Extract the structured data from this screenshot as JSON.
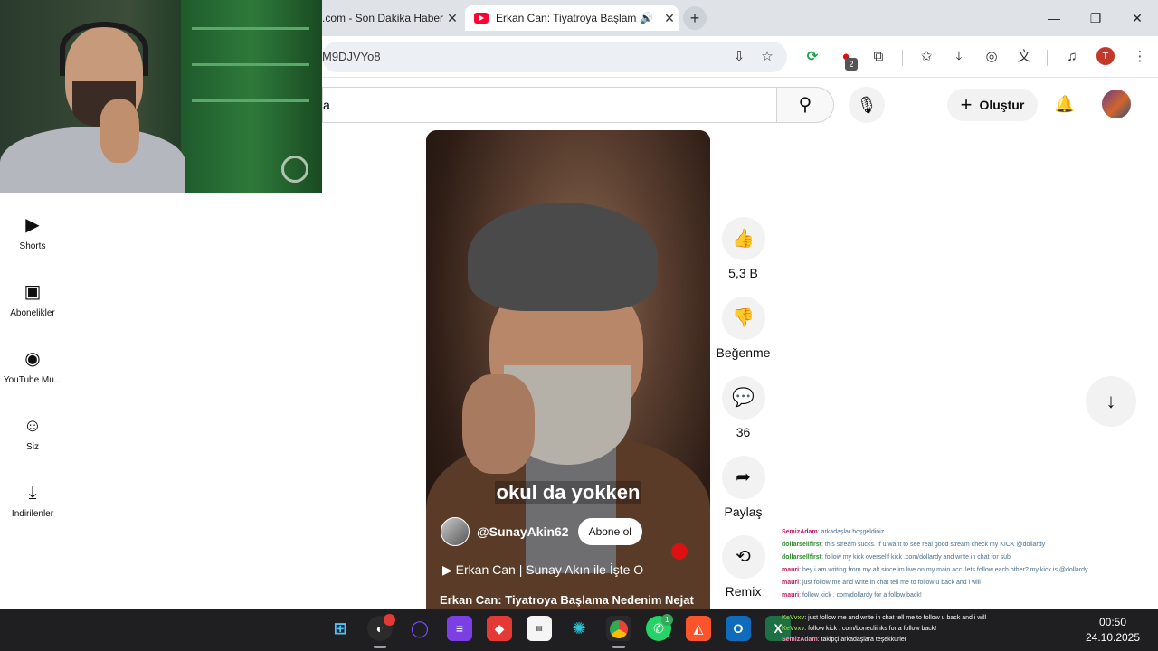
{
  "browser": {
    "tabs": [
      {
        "label": ".com - Son Dakika Haberleri",
        "close": "✕"
      },
      {
        "label": "Erkan Can: Tiyatroya Başlama Nedenim",
        "close": "✕",
        "audio": "🔊"
      }
    ],
    "new_tab": "+",
    "window": {
      "minimize": "—",
      "maximize": "❐",
      "close": "✕"
    },
    "url": "M9DJVYo8",
    "extension_badge": "2",
    "profile_initial": "T"
  },
  "youtube": {
    "search_value": "a",
    "create_label": "Oluştur",
    "guide": [
      {
        "label": "Shorts"
      },
      {
        "label": "Abonelikler"
      },
      {
        "label": "YouTube Mu..."
      },
      {
        "label": "Siz"
      },
      {
        "label": "İndirilenler"
      }
    ],
    "short": {
      "subtitle": "okul da yokken",
      "channel": "@SunayAkin62",
      "subscribe": "Abone ol",
      "playlist": "Erkan Can | Sunay Akın ile İşte O",
      "playlist_prefix": "▶",
      "title": "Erkan Can: Tiyatroya Başlama Nedenim Nejat"
    },
    "actions": {
      "like": "5,3 B",
      "dislike": "Beğenme",
      "comments": "36",
      "share": "Paylaş",
      "remix": "Remix"
    }
  },
  "chat": [
    {
      "user": "SemizAdam",
      "msg": ": arkadaşlar hoşgeldiniz...",
      "color": "pink"
    },
    {
      "user": "dollarsellfirst",
      "msg": ": this stream sucks. If u want to see real good stream check my KICK @dollardy",
      "color": ""
    },
    {
      "user": "dollarsellfirst",
      "msg": ": follow my kick oversellf kick .com/dollardy and write in chat for sub",
      "color": ""
    },
    {
      "user": "mauri",
      "msg": ": hey i am writing from my alt since im live on my main acc. lets follow each other? my kick is @dollardy",
      "color": "pink"
    },
    {
      "user": "mauri",
      "msg": ": just follow me and write in chat tell me to follow u back and i will",
      "color": "pink"
    },
    {
      "user": "mauri",
      "msg": ": follow kick . com/dollardy for a follow back!",
      "color": "pink"
    }
  ],
  "tray_chat": [
    {
      "user": "KeVvxv",
      "msg": ": just follow me and write in chat tell me to follow u back and i will"
    },
    {
      "user": "KeVvxv",
      "msg": ": follow kick . com/bonecliinks for a follow back!"
    },
    {
      "user": "SemizAdam",
      "msg": ": takipçi arkadaşlara teşekkürler"
    }
  ],
  "taskbar": {
    "badge_whatsapp": "1",
    "time": "00:50",
    "date": "24.10.2025"
  }
}
